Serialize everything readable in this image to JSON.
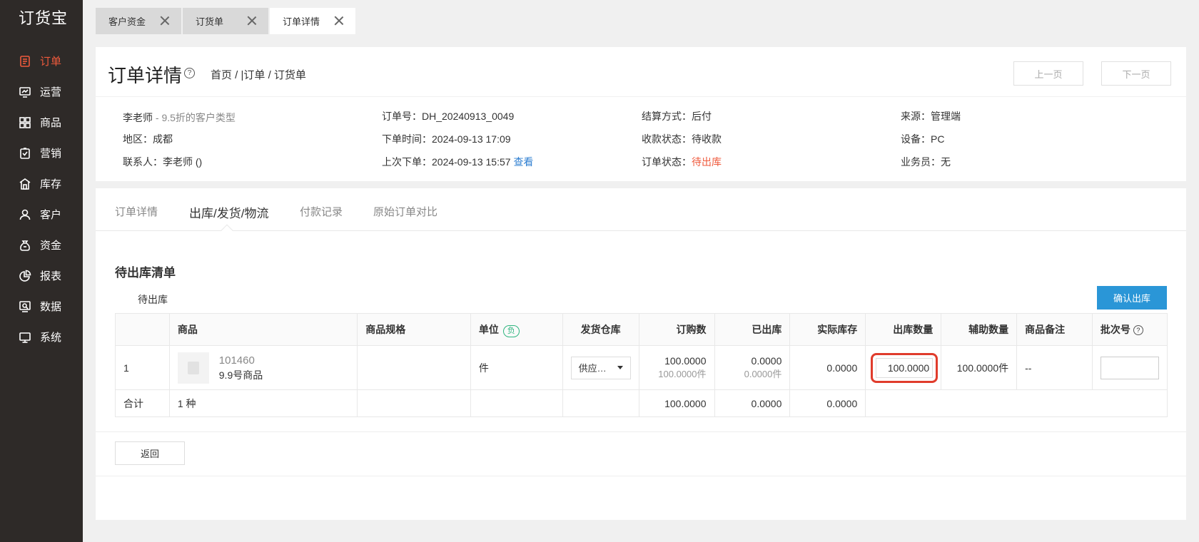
{
  "logo": "订货宝",
  "sidebar": {
    "items": [
      {
        "label": "订单",
        "icon": "order-icon"
      },
      {
        "label": "运营",
        "icon": "operations-icon"
      },
      {
        "label": "商品",
        "icon": "goods-icon"
      },
      {
        "label": "营销",
        "icon": "marketing-icon"
      },
      {
        "label": "库存",
        "icon": "warehouse-icon"
      },
      {
        "label": "客户",
        "icon": "customer-icon"
      },
      {
        "label": "资金",
        "icon": "money-bag-icon"
      },
      {
        "label": "报表",
        "icon": "pie-chart-icon"
      },
      {
        "label": "数据",
        "icon": "data-search-icon"
      },
      {
        "label": "系统",
        "icon": "monitor-icon"
      }
    ],
    "active_color": "#ef5a3c"
  },
  "tabs": [
    {
      "label": "客户资金"
    },
    {
      "label": "订货单"
    },
    {
      "label": "订单详情"
    }
  ],
  "header": {
    "title": "订单详情",
    "help": "?",
    "breadcrumb": "首页 / |订单 / 订货单",
    "prev": "上一页",
    "next": "下一页"
  },
  "info": {
    "customer": "李老师",
    "customer_type": " - 9.5折的客户类型",
    "region": "地区：成都",
    "contact": "联系人：李老师   ()",
    "order_no": "订单号：DH_20240913_0049",
    "order_time": "下单时间：2024-09-13 17:09",
    "last_order": "上次下单：2024-09-13 15:57",
    "view": "查看",
    "settlement": "结算方式：后付",
    "pay_status": "收款状态：待收款",
    "order_status_label": "订单状态：",
    "order_status": "待出库",
    "source": "来源：管理端",
    "device": "设备：PC",
    "salesman": "业务员：无"
  },
  "subtabs": [
    "订单详情",
    "出库/发货/物流",
    "付款记录",
    "原始订单对比"
  ],
  "section": {
    "title": "待出库清单",
    "subtitle": "待出库",
    "confirm": "确认出库"
  },
  "table": {
    "headers": [
      "",
      "商品",
      "商品规格",
      "单位",
      "发货仓库",
      "订购数",
      "已出库",
      "实际库存",
      "出库数量",
      "辅助数量",
      "商品备注",
      "批次号"
    ],
    "unit_badge": "负",
    "row": {
      "index": "1",
      "code": "101460",
      "name": "9.9号商品",
      "spec": "",
      "unit": "件",
      "warehouse": "供应…",
      "ordered": "100.0000",
      "ordered_sub": "100.0000件",
      "shipped": "0.0000",
      "shipped_sub": "0.0000件",
      "stock": "0.0000",
      "out_qty": "100.0000",
      "aux_qty": "100.0000件",
      "remark": "--"
    },
    "total": {
      "label": "合计",
      "kinds": "1 种",
      "ordered": "100.0000",
      "shipped": "0.0000",
      "stock": "0.0000"
    }
  },
  "back": "返回"
}
